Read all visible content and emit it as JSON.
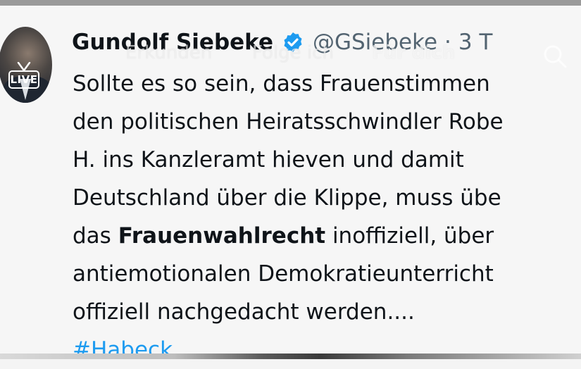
{
  "author": {
    "name": "Gundolf Siebeke",
    "handle": "@GSiebeke",
    "separator": "·",
    "time": "3 T",
    "verified_icon": "verified-badge-icon",
    "verified_color": "#1d9bf0"
  },
  "avatar": {
    "badge_label": "LIVE"
  },
  "overlay_nav": {
    "explore": "Erkunden",
    "following": "Folge ich",
    "for_you": "Für dich",
    "search_icon": "search-icon"
  },
  "tweet": {
    "line1": "Sollte es so sein, dass Frauenstimmen",
    "line2": "den politischen Heiratsschwindler Robe",
    "line3": "H. ins Kanzleramt hieven und damit",
    "line4": "Deutschland über die Klippe, muss übe",
    "line5_pre": "das ",
    "line5_bold": "Frauenwahlrecht",
    "line5_post": " inoffiziell, über",
    "line6": "antiemotionalen Demokratieunterricht",
    "line7": "offiziell nachgedacht werden....",
    "hashtag": "#Habeck"
  },
  "colors": {
    "text": "#0f1419",
    "secondary": "#536471",
    "link": "#1d9bf0",
    "background": "#f6f6f6"
  }
}
